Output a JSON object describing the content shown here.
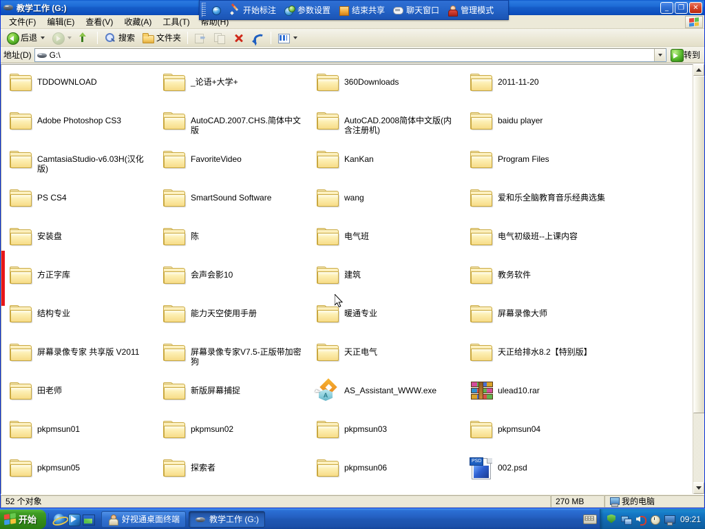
{
  "window": {
    "title": "教学工作 (G:)",
    "icon": "hard-drive-icon",
    "minimize_label": "_",
    "maximize_label": "❐",
    "close_label": "✕"
  },
  "menubar": {
    "items": [
      {
        "label": "文件(F)",
        "name": "menu-file"
      },
      {
        "label": "编辑(E)",
        "name": "menu-edit"
      },
      {
        "label": "查看(V)",
        "name": "menu-view"
      },
      {
        "label": "收藏(A)",
        "name": "menu-favorites"
      },
      {
        "label": "工具(T)",
        "name": "menu-tools"
      },
      {
        "label": "帮助(H)",
        "name": "menu-help"
      }
    ]
  },
  "toolbar": {
    "back_label": "后退",
    "search_label": "搜索",
    "folders_label": "文件夹",
    "icons": {
      "back": "back-arrow-icon",
      "back_dropdown": "chevron-down-icon",
      "forward": "forward-arrow-icon",
      "forward_dropdown": "chevron-down-icon",
      "up": "up-folder-icon",
      "search": "search-icon",
      "folders": "folder-icon",
      "move_to": "move-to-folder-icon",
      "copy_to": "copy-to-folder-icon",
      "delete": "delete-x-icon",
      "undo": "undo-arrow-icon",
      "views": "views-icon",
      "views_dropdown": "chevron-down-icon"
    }
  },
  "address": {
    "label": "地址(D)",
    "value": "G:\\",
    "icon": "hard-drive-icon",
    "dropdown_icon": "chevron-down-icon",
    "go_label": "转到",
    "go_icon": "go-arrow-icon"
  },
  "floating_toolbar": {
    "name": "remote-classroom-toolbar",
    "grip": "drag-grip",
    "items": [
      {
        "label": "",
        "icon": "globe-icon",
        "name": "ft-globe-button"
      },
      {
        "label": "开始标注",
        "icon": "pen-icon",
        "name": "ft-start-annotation-button"
      },
      {
        "label": "参数设置",
        "icon": "settings-icon",
        "name": "ft-parameter-settings-button"
      },
      {
        "label": "结束共享",
        "icon": "stop-share-icon",
        "name": "ft-end-share-button"
      },
      {
        "label": "聊天窗口",
        "icon": "chat-icon",
        "name": "ft-chat-window-button"
      },
      {
        "label": "管理模式",
        "icon": "admin-person-icon",
        "name": "ft-admin-mode-button"
      }
    ]
  },
  "files": [
    {
      "name": "TDDOWNLOAD",
      "type": "folder"
    },
    {
      "name": "_论语+大学+",
      "type": "folder"
    },
    {
      "name": "360Downloads",
      "type": "folder"
    },
    {
      "name": "2011-11-20",
      "type": "folder"
    },
    {
      "name": "Adobe Photoshop CS3",
      "type": "folder"
    },
    {
      "name": "AutoCAD.2007.CHS.简体中文版",
      "type": "folder"
    },
    {
      "name": "AutoCAD.2008简体中文版(内含注册机)",
      "type": "folder"
    },
    {
      "name": "baidu player",
      "type": "folder"
    },
    {
      "name": "CamtasiaStudio-v6.03H(汉化版)",
      "type": "folder"
    },
    {
      "name": "FavoriteVideo",
      "type": "folder"
    },
    {
      "name": "KanKan",
      "type": "folder"
    },
    {
      "name": "Program Files",
      "type": "folder"
    },
    {
      "name": "PS CS4",
      "type": "folder"
    },
    {
      "name": "SmartSound Software",
      "type": "folder"
    },
    {
      "name": "wang",
      "type": "folder"
    },
    {
      "name": "爱和乐全脑教育音乐经典选集",
      "type": "folder"
    },
    {
      "name": "安装盘",
      "type": "folder"
    },
    {
      "name": "陈",
      "type": "folder"
    },
    {
      "name": "电气班",
      "type": "folder"
    },
    {
      "name": "电气初级班--上课内容",
      "type": "folder"
    },
    {
      "name": "方正字库",
      "type": "folder"
    },
    {
      "name": "会声会影10",
      "type": "folder"
    },
    {
      "name": "建筑",
      "type": "folder"
    },
    {
      "name": "教务软件",
      "type": "folder"
    },
    {
      "name": "结构专业",
      "type": "folder"
    },
    {
      "name": "能力天空使用手册",
      "type": "folder"
    },
    {
      "name": "暖通专业",
      "type": "folder"
    },
    {
      "name": "屏幕录像大师",
      "type": "folder"
    },
    {
      "name": "屏幕录像专家 共享版 V2011",
      "type": "folder"
    },
    {
      "name": "屏幕录像专家V7.5-正版带加密狗",
      "type": "folder"
    },
    {
      "name": "天正电气",
      "type": "folder"
    },
    {
      "name": "天正给排水8.2【特别版】",
      "type": "folder"
    },
    {
      "name": "田老师",
      "type": "folder"
    },
    {
      "name": "新版屏幕捕捉",
      "type": "folder"
    },
    {
      "name": "AS_Assistant_WWW.exe",
      "type": "exe"
    },
    {
      "name": "ulead10.rar",
      "type": "rar"
    },
    {
      "name": "pkpmsun01",
      "type": "folder"
    },
    {
      "name": "pkpmsun02",
      "type": "folder"
    },
    {
      "name": "pkpmsun03",
      "type": "folder"
    },
    {
      "name": "pkpmsun04",
      "type": "folder"
    },
    {
      "name": "pkpmsun05",
      "type": "folder"
    },
    {
      "name": "探索者",
      "type": "folder"
    },
    {
      "name": "pkpmsun06",
      "type": "folder"
    },
    {
      "name": "002.psd",
      "type": "psd"
    }
  ],
  "statusbar": {
    "object_count": "52 个对象",
    "size": "270 MB",
    "location": "我的电脑",
    "location_icon": "my-computer-icon"
  },
  "scrollbar": {
    "up_icon": "scroll-up-arrow-icon",
    "down_icon": "scroll-down-arrow-icon",
    "thumb": "scroll-thumb"
  },
  "taskbar": {
    "start_label": "开始",
    "start_icon": "windows-flag-icon",
    "quicklaunch": [
      {
        "name": "ql-internet-explorer-icon",
        "icon": "internet-explorer-icon"
      },
      {
        "name": "ql-media-player-icon",
        "icon": "blue-app-icon"
      },
      {
        "name": "ql-picture-viewer-icon",
        "icon": "picture-viewer-icon"
      }
    ],
    "tasks": [
      {
        "label": "好视通桌面终端",
        "icon": "person-app-icon",
        "active": false
      },
      {
        "label": "教学工作 (G:)",
        "icon": "hard-drive-icon",
        "active": true
      }
    ],
    "keyboard_icon": "keyboard-icon",
    "tray": [
      {
        "name": "tray-shield-icon",
        "icon": "shield-icon"
      },
      {
        "name": "tray-network-icon",
        "icon": "network-icon"
      },
      {
        "name": "tray-volume-icon",
        "icon": "volume-icon"
      },
      {
        "name": "tray-clock-app-icon",
        "icon": "clock-icon"
      },
      {
        "name": "tray-display-icon",
        "icon": "display-icon"
      }
    ],
    "clock": "09:21"
  },
  "colors": {
    "titlebar_blue": "#1d6bd6",
    "taskbar_blue": "#245fc0",
    "start_green": "#338c19",
    "chrome": "#ece9d8",
    "folder_yellow": "#f7dc87",
    "marker_red": "#e8161a"
  }
}
